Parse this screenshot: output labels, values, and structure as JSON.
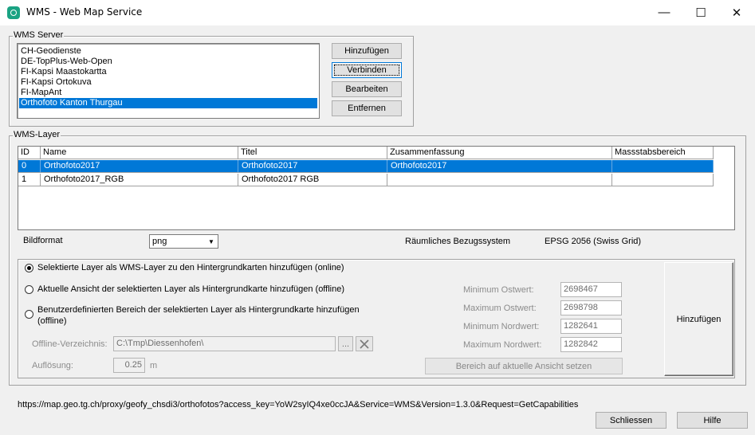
{
  "window": {
    "title": "WMS - Web Map Service",
    "minimize_glyph": "—",
    "maximize_glyph": "☐",
    "close_glyph": "✕"
  },
  "wms_server": {
    "legend": "WMS Server",
    "servers": [
      "CH-Geodienste",
      "DE-TopPlus-Web-Open",
      "FI-Kapsi Maastokartta",
      "FI-Kapsi Ortokuva",
      "FI-MapAnt",
      "Orthofoto Kanton Thurgau"
    ],
    "selected_server": "Orthofoto Kanton Thurgau",
    "buttons": {
      "add": "Hinzufügen",
      "connect": "Verbinden",
      "edit": "Bearbeiten",
      "remove": "Entfernen"
    }
  },
  "wms_layer": {
    "legend": "WMS-Layer",
    "columns": [
      "ID",
      "Name",
      "Titel",
      "Zusammenfassung",
      "Massstabsbereich"
    ],
    "rows": [
      {
        "id": "0",
        "name": "Orthofoto2017",
        "title": "Orthofoto2017",
        "summary": "Orthofoto2017",
        "scale": ""
      },
      {
        "id": "1",
        "name": "Orthofoto2017_RGB",
        "title": "Orthofoto2017 RGB",
        "summary": "",
        "scale": ""
      }
    ],
    "selected_row_id": "0",
    "image_format_label": "Bildformat",
    "image_format_value": "png",
    "crs_label": "Räumliches Bezugssystem",
    "crs_value": "EPSG 2056 (Swiss Grid)"
  },
  "options": {
    "radio_online": "Selektierte Layer als WMS-Layer zu den Hintergrundkarten hinzufügen (online)",
    "radio_offline_view": "Aktuelle Ansicht der selektierten Layer als Hintergrundkarte hinzufügen (offline)",
    "radio_offline_custom_line1": "Benutzerdefinierten Bereich der selektierten Layer als Hintergrundkarte hinzufügen",
    "radio_offline_custom_line2": "(offline)",
    "selected_option": "online",
    "offline_dir_label": "Offline-Verzeichnis:",
    "offline_dir_value": "C:\\Tmp\\Diessenhofen\\",
    "browse_label": "...",
    "resolution_label": "Auflösung:",
    "resolution_value": "0.25",
    "resolution_unit": "m",
    "min_east_label": "Minimum Ostwert:",
    "min_east_value": "2698467",
    "max_east_label": "Maximum Ostwert:",
    "max_east_value": "2698798",
    "min_north_label": "Minimum Nordwert:",
    "min_north_value": "1282641",
    "max_north_label": "Maximum Nordwert:",
    "max_north_value": "1282842",
    "set_area_button": "Bereich auf aktuelle Ansicht setzen",
    "add_button": "Hinzufügen"
  },
  "status_url": "https://map.geo.tg.ch/proxy/geofy_chsdi3/orthofotos?access_key=YoW2syIQ4xe0ccJA&Service=WMS&Version=1.3.0&Request=GetCapabilities",
  "footer": {
    "close_button": "Schliessen",
    "help_button": "Hilfe"
  },
  "colors": {
    "selection": "#0078d7",
    "app_icon": "#1aa383"
  }
}
